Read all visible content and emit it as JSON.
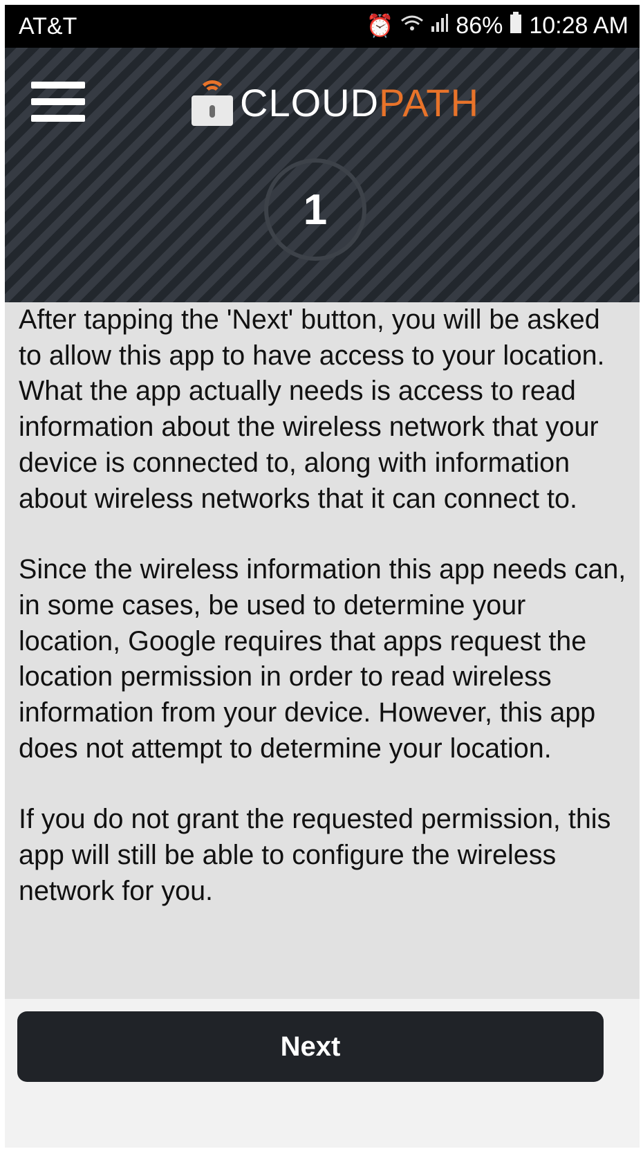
{
  "status_bar": {
    "carrier": "AT&T",
    "battery": "86%",
    "time": "10:28 AM",
    "icons": [
      "alarm-icon",
      "wifi-icon",
      "signal-icon",
      "battery-icon"
    ]
  },
  "header": {
    "brand_part1": "CLOUD",
    "brand_part2": "PATH",
    "step_number": "1",
    "accent_color": "#e8732a"
  },
  "content": {
    "paragraphs": [
      "After tapping the 'Next' button, you will be asked to allow this app to have access to your location. What the app actually needs is access to read information about the wireless network that your device is connected to, along with information about wireless networks that it can connect to.",
      "Since the wireless information this app needs can, in some cases, be used to determine your location, Google requires that apps request the location permission in order to read wireless information from your device. However, this app does not attempt to determine your location.",
      "If you do not grant the requested permission, this app will still be able to configure the wireless network for you."
    ]
  },
  "footer": {
    "next_label": "Next"
  }
}
